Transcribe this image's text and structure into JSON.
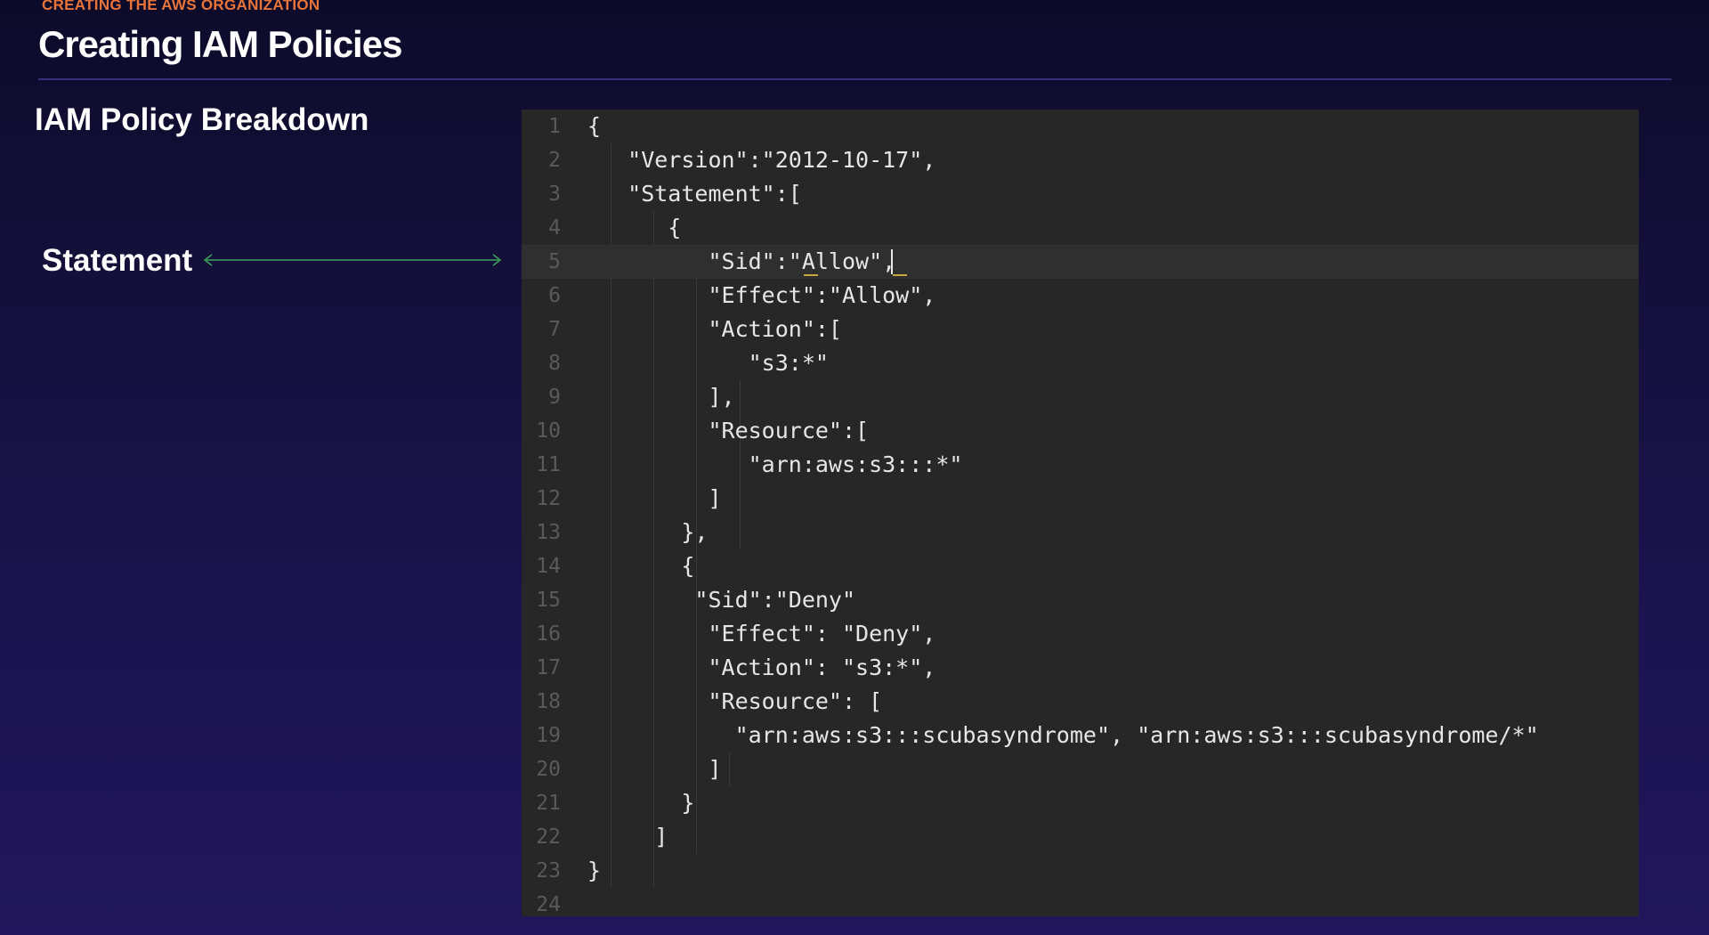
{
  "header": {
    "section_label": "CREATING THE AWS ORGANIZATION",
    "title": "Creating IAM Policies",
    "subtitle": "IAM Policy Breakdown"
  },
  "callout": {
    "label": "Statement",
    "target_line": 5,
    "arrow_color": "#3aa45a"
  },
  "editor": {
    "background": "#272727",
    "current_line": 5,
    "lines": [
      {
        "n": "1",
        "text": "{"
      },
      {
        "n": "2",
        "text": "   \"Version\":\"2012-10-17\","
      },
      {
        "n": "3",
        "text": "   \"Statement\":["
      },
      {
        "n": "4",
        "text": "      {"
      },
      {
        "n": "5",
        "text": "         \"Sid\":\"Allow\","
      },
      {
        "n": "6",
        "text": "         \"Effect\":\"Allow\","
      },
      {
        "n": "7",
        "text": "         \"Action\":["
      },
      {
        "n": "8",
        "text": "            \"s3:*\""
      },
      {
        "n": "9",
        "text": "         ],"
      },
      {
        "n": "10",
        "text": "         \"Resource\":["
      },
      {
        "n": "11",
        "text": "            \"arn:aws:s3:::*\""
      },
      {
        "n": "12",
        "text": "         ]"
      },
      {
        "n": "13",
        "text": "       },"
      },
      {
        "n": "14",
        "text": "       {"
      },
      {
        "n": "15",
        "text": "        \"Sid\":\"Deny\""
      },
      {
        "n": "16",
        "text": "         \"Effect\": \"Deny\","
      },
      {
        "n": "17",
        "text": "         \"Action\": \"s3:*\","
      },
      {
        "n": "18",
        "text": "         \"Resource\": ["
      },
      {
        "n": "19",
        "text": "           \"arn:aws:s3:::scubasyndrome\", \"arn:aws:s3:::scubasyndrome/*\""
      },
      {
        "n": "20",
        "text": "         ]"
      },
      {
        "n": "21",
        "text": "       }"
      },
      {
        "n": "22",
        "text": "     ]"
      },
      {
        "n": "23",
        "text": "}"
      },
      {
        "n": "24",
        "text": ""
      }
    ]
  }
}
